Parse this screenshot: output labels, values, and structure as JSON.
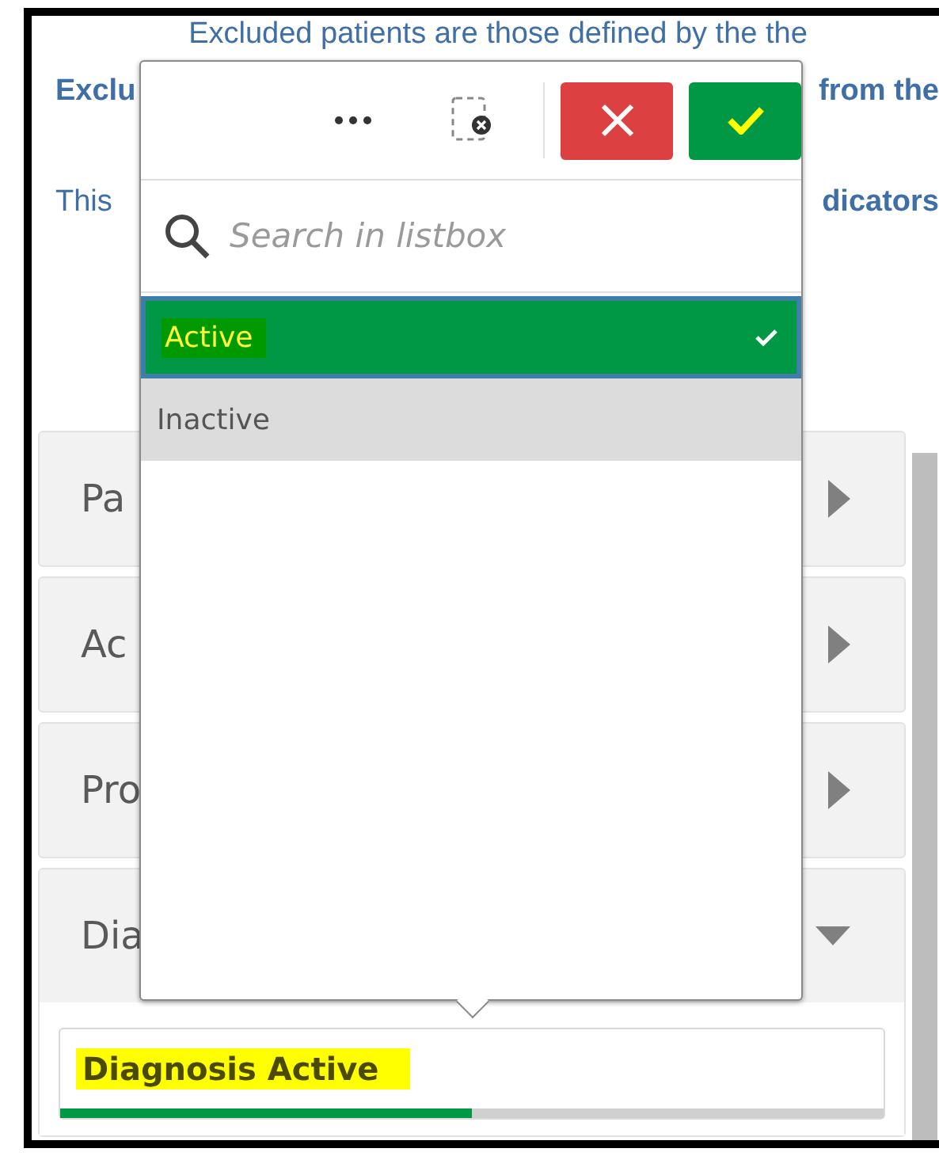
{
  "intro": {
    "line_1": "Excluded patients are those defined by the the",
    "line_2_left": "Exclu",
    "line_2_right": "from the",
    "line_3_left": "This",
    "line_3_right": "dicators"
  },
  "sections": [
    {
      "label": "Pa",
      "expanded": false
    },
    {
      "label": "Ac",
      "expanded": false
    },
    {
      "label": "Pro",
      "expanded": false
    },
    {
      "label": "Dia",
      "expanded": true
    }
  ],
  "selection_field": {
    "value": "Diagnosis Active",
    "level": 0.5
  },
  "listbox": {
    "search": {
      "placeholder": "Search in listbox"
    },
    "items": [
      {
        "label": "Active",
        "selected": true
      },
      {
        "label": "Inactive",
        "selected": false
      }
    ]
  }
}
